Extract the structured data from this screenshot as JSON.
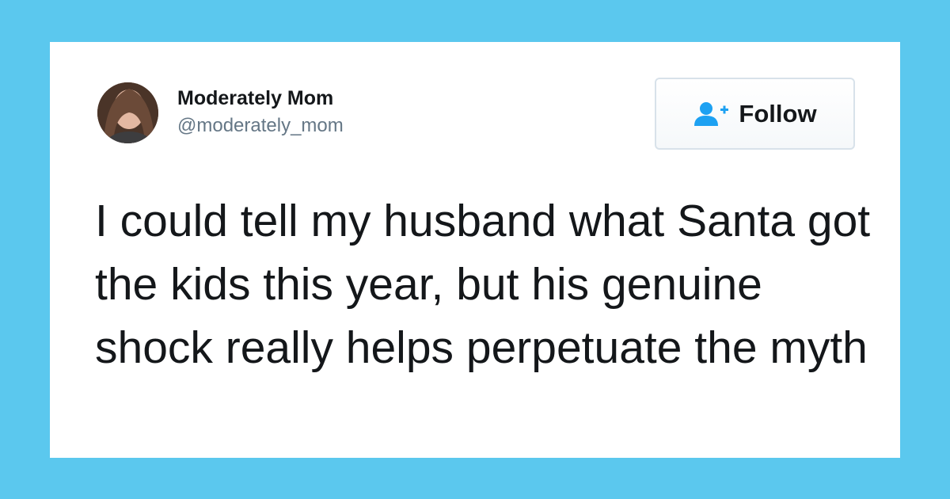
{
  "tweet": {
    "author": {
      "display_name": "Moderately Mom",
      "handle": "@moderately_mom"
    },
    "follow_button": {
      "label": "Follow",
      "icon": "add-user-icon"
    },
    "text": "I could tell my husband what Santa got the kids this year, but his genuine shock really helps perpetuate the myth"
  },
  "colors": {
    "background": "#5bc8ee",
    "card": "#ffffff",
    "text": "#14171a",
    "handle": "#657786",
    "accent": "#1da1f2"
  }
}
